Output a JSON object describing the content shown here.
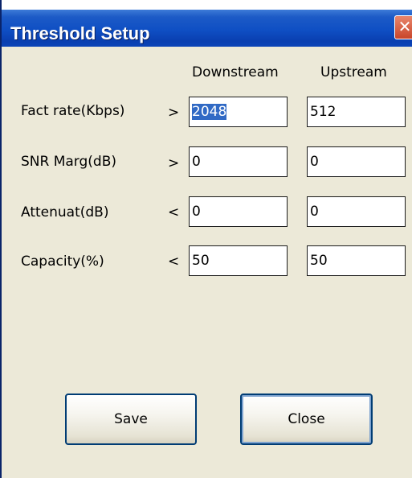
{
  "window": {
    "title": "Threshold Setup",
    "close_glyph": "✕"
  },
  "columns": {
    "downstream": "Downstream",
    "upstream": "Upstream"
  },
  "rows": [
    {
      "label": "Fact rate(Kbps)",
      "op": ">",
      "downstream": "2048",
      "upstream": "512",
      "downstream_selected": true
    },
    {
      "label": "SNR Marg(dB)",
      "op": ">",
      "downstream": "0",
      "upstream": "0"
    },
    {
      "label": "Attenuat(dB)",
      "op": "<",
      "downstream": "0",
      "upstream": "0"
    },
    {
      "label": "Capacity(%)",
      "op": "<",
      "downstream": "50",
      "upstream": "50"
    }
  ],
  "buttons": {
    "save": "Save",
    "close": "Close"
  },
  "colors": {
    "titlebar": "#0f4fc4",
    "dialog_bg": "#ece9d8",
    "selection": "#316ac5",
    "close_button": "#c8452a"
  }
}
